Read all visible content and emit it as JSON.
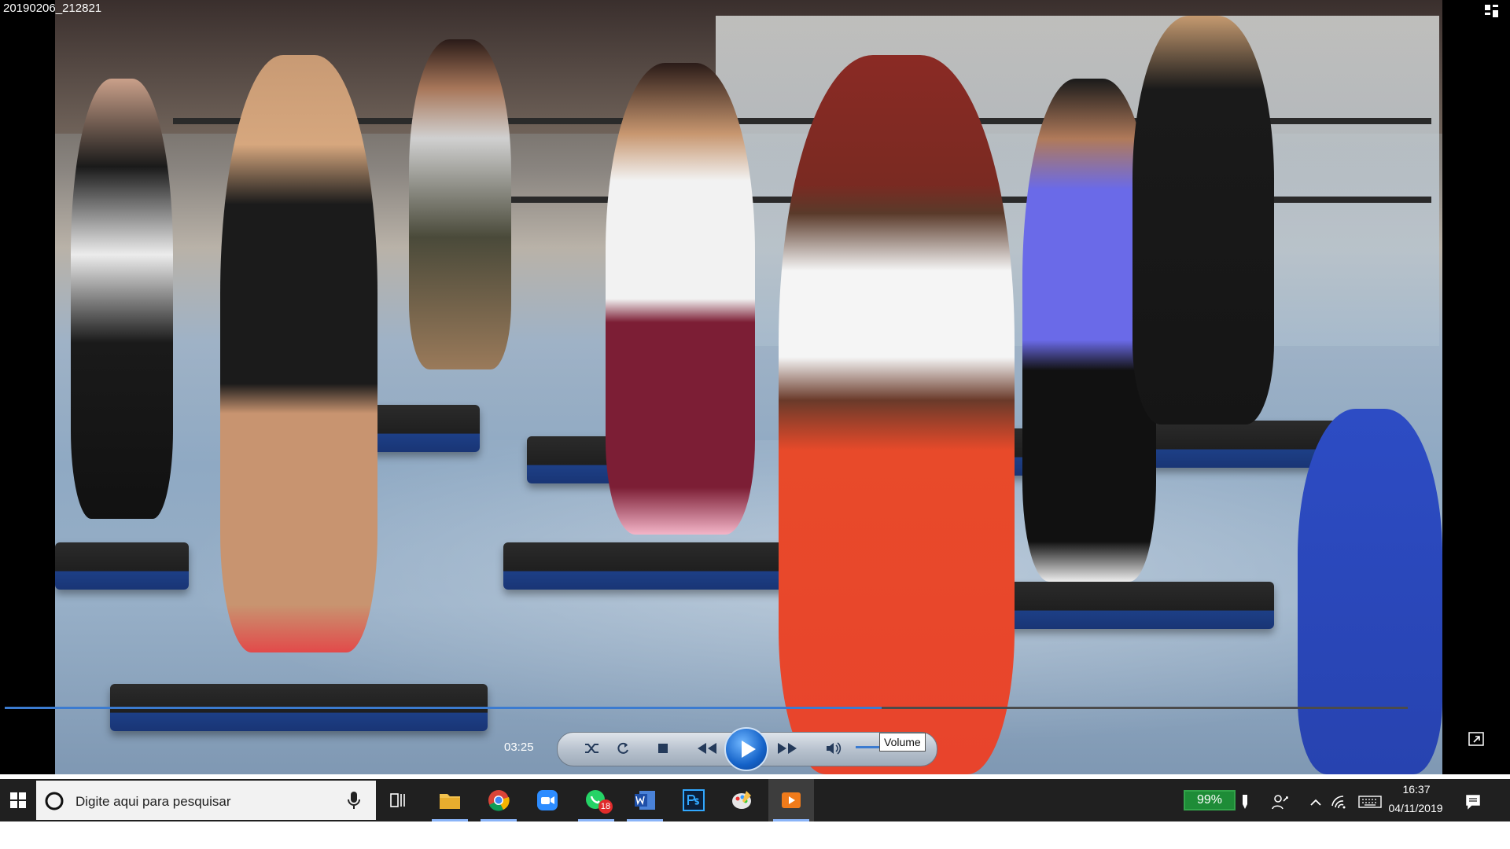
{
  "window": {
    "title": "20190206_212821"
  },
  "player": {
    "elapsed_time": "03:25",
    "progress_fraction": 0.625,
    "volume_fraction": 0.35,
    "tooltip": "Volume",
    "controls": [
      {
        "name": "shuffle-icon"
      },
      {
        "name": "repeat-icon"
      },
      {
        "name": "stop-icon"
      },
      {
        "name": "rewind-icon"
      },
      {
        "name": "play-icon"
      },
      {
        "name": "fast-forward-icon"
      },
      {
        "name": "speaker-icon"
      }
    ],
    "colors": {
      "accent": "#3b7bd0",
      "play_button": "#1462c8"
    }
  },
  "taskbar": {
    "search_placeholder": "Digite aqui para pesquisar",
    "apps": [
      {
        "name": "file-explorer-icon"
      },
      {
        "name": "chrome-icon"
      },
      {
        "name": "zoom-icon"
      },
      {
        "name": "whatsapp-icon",
        "badge": "18"
      },
      {
        "name": "word-icon"
      },
      {
        "name": "photoshop-icon"
      },
      {
        "name": "paint-icon"
      },
      {
        "name": "media-player-icon"
      }
    ],
    "battery": "99%",
    "time": "16:37",
    "date": "04/11/2019"
  }
}
